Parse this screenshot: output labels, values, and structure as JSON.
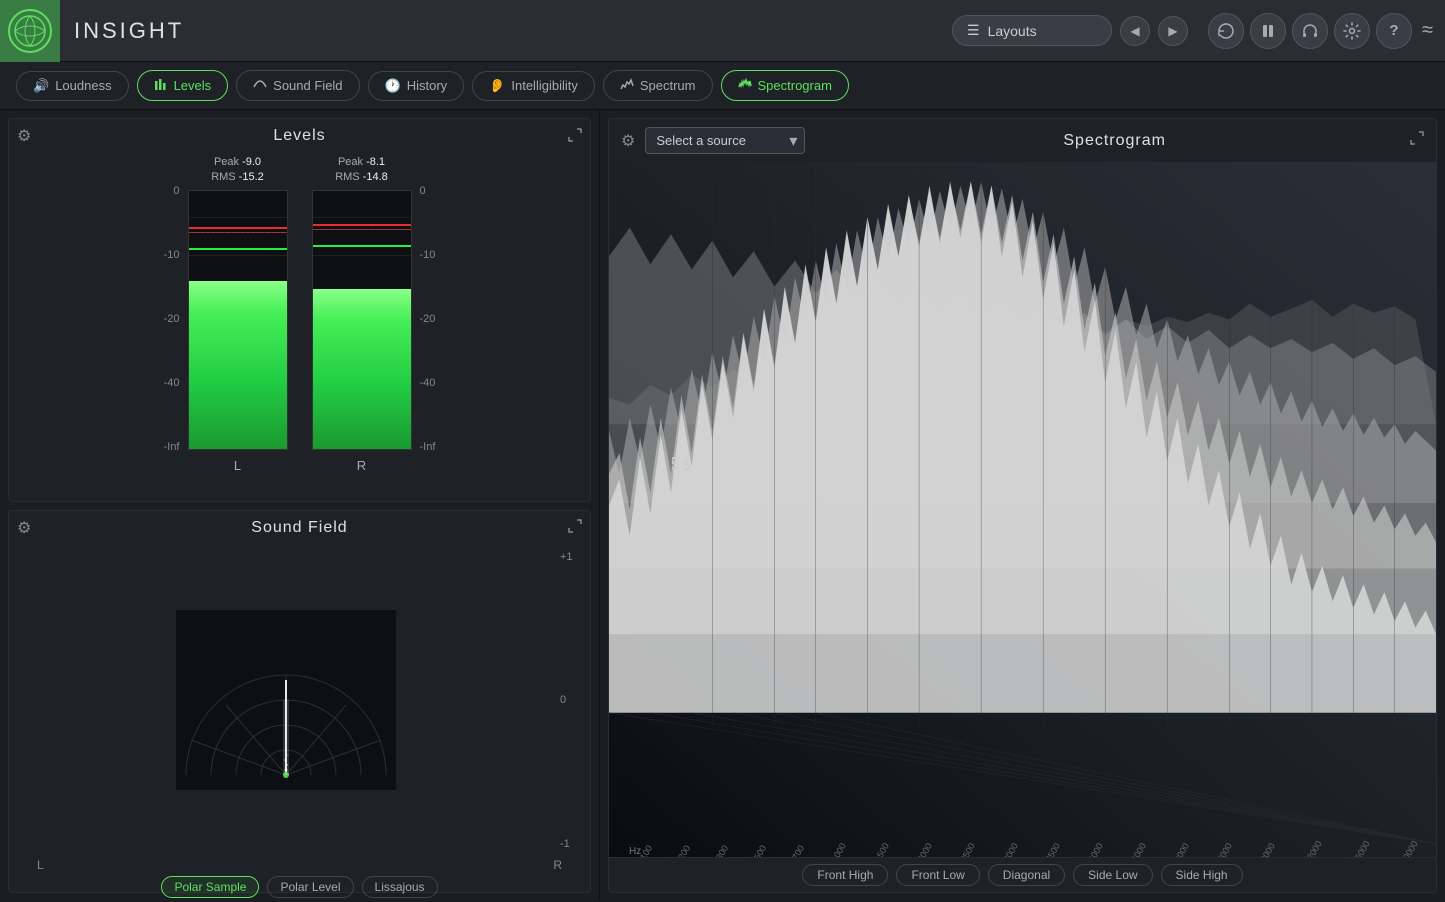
{
  "app": {
    "title": "INSIGHT"
  },
  "header": {
    "layouts_label": "Layouts",
    "nav_prev": "◀",
    "nav_next": "▶"
  },
  "tabs": [
    {
      "id": "loudness",
      "label": "Loudness",
      "icon": "🔊",
      "active": false
    },
    {
      "id": "levels",
      "label": "Levels",
      "icon": "📊",
      "active": true
    },
    {
      "id": "soundfield",
      "label": "Sound Field",
      "icon": "〰",
      "active": false
    },
    {
      "id": "history",
      "label": "History",
      "icon": "🕐",
      "active": false
    },
    {
      "id": "intelligibility",
      "label": "Intelligibility",
      "icon": "👂",
      "active": false
    },
    {
      "id": "spectrum",
      "label": "Spectrum",
      "icon": "📈",
      "active": false
    },
    {
      "id": "spectrogram",
      "label": "Spectrogram",
      "icon": "〰",
      "active": true
    }
  ],
  "levels": {
    "title": "Levels",
    "channels": [
      {
        "label": "L",
        "peak": "-9.0",
        "rms": "-15.2",
        "fill_pct": 65,
        "peak_line_pct": 86,
        "rms_line_pct": 78
      },
      {
        "label": "R",
        "peak": "-8.1",
        "rms": "-14.8",
        "fill_pct": 62,
        "peak_line_pct": 87,
        "rms_line_pct": 79
      }
    ],
    "scale": [
      "0",
      "-10",
      "-20",
      "-40",
      "-Inf"
    ],
    "peak_label": "Peak",
    "rms_label": "RMS"
  },
  "soundfield": {
    "title": "Sound Field",
    "scale": [
      "+1",
      "0",
      "-1"
    ],
    "left_label": "L",
    "right_label": "R",
    "modes": [
      {
        "id": "polar_sample",
        "label": "Polar Sample",
        "active": true
      },
      {
        "id": "polar_level",
        "label": "Polar Level",
        "active": false
      },
      {
        "id": "lissajous",
        "label": "Lissajous",
        "active": false
      }
    ]
  },
  "spectrogram": {
    "title": "Spectrogram",
    "source_placeholder": "Select a source",
    "time_label": "5 s",
    "freq_labels": [
      "100",
      "200",
      "300",
      "500",
      "700",
      "1000",
      "1500",
      "2000",
      "2500",
      "3000",
      "3500",
      "4000",
      "5000",
      "6000",
      "7000",
      "9000",
      "12000",
      "15000",
      "20000"
    ],
    "hz_label": "Hz",
    "view_buttons": [
      {
        "id": "front_high",
        "label": "Front High"
      },
      {
        "id": "front_low",
        "label": "Front Low"
      },
      {
        "id": "diagonal",
        "label": "Diagonal"
      },
      {
        "id": "side_low",
        "label": "Side Low"
      },
      {
        "id": "side_high",
        "label": "Side High"
      }
    ]
  },
  "colors": {
    "accent_green": "#5de05d",
    "bg_dark": "#1a1d21",
    "bg_panel": "#1e2126",
    "border": "#2a2d35"
  }
}
